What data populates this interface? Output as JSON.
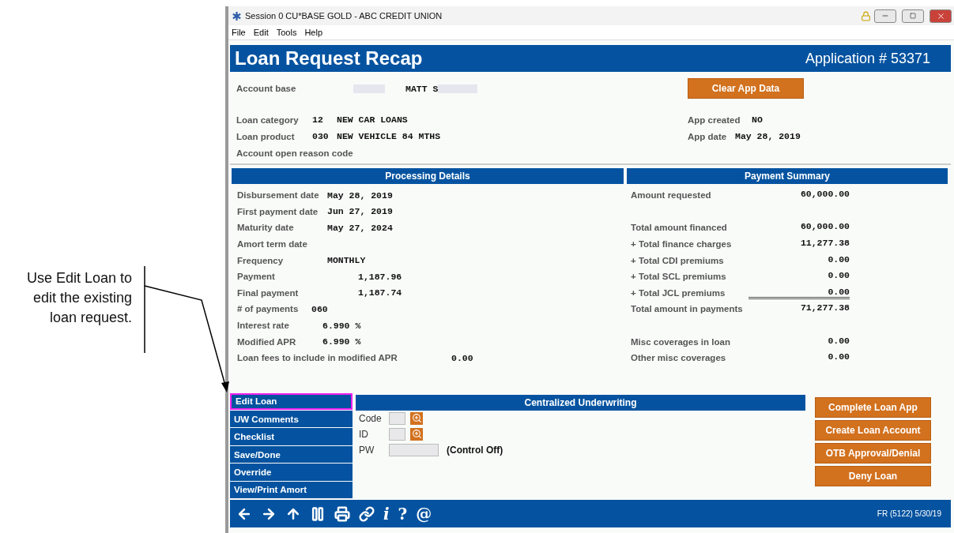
{
  "callout": {
    "text": "Use Edit Loan to edit the existing loan request."
  },
  "window": {
    "title": "Session 0 CU*BASE GOLD - ABC CREDIT UNION"
  },
  "menu": [
    "File",
    "Edit",
    "Tools",
    "Help"
  ],
  "header": {
    "title": "Loan Request Recap",
    "application": "Application # 53371"
  },
  "account": {
    "label": "Account base",
    "name": "MATT S"
  },
  "clear_button": "Clear App Data",
  "loan_info": [
    {
      "label": "Loan category",
      "code": "12",
      "value": "NEW CAR LOANS"
    },
    {
      "label": "Loan product",
      "code": "030",
      "value": "NEW VEHICLE 84 MTHS"
    },
    {
      "label": "Account open reason code"
    }
  ],
  "app_info": [
    {
      "label": "App created",
      "value": "NO"
    },
    {
      "label": "App date",
      "value": "May 28, 2019"
    }
  ],
  "processing": {
    "title": "Processing Details",
    "rows": [
      {
        "label": "Disbursement date",
        "value": "May 28, 2019",
        "kind": "date"
      },
      {
        "label": "First payment date",
        "value": "Jun 27, 2019",
        "kind": "date"
      },
      {
        "label": "Maturity date",
        "value": "May 27, 2024",
        "kind": "date"
      },
      {
        "label": "Amort term date",
        "kind": "date"
      },
      {
        "label": "Frequency",
        "value": "MONTHLY",
        "kind": "date"
      },
      {
        "label": "Payment",
        "value": "1,187.96",
        "kind": "amount"
      },
      {
        "label": "Final payment",
        "value": "1,187.74",
        "kind": "amount"
      },
      {
        "label": "# of payments",
        "value": "060",
        "kind": "count"
      },
      {
        "label": "Interest rate",
        "value": "6.990 %",
        "kind": "rate"
      },
      {
        "label": "Modified APR",
        "value": "6.990 %",
        "kind": "rate"
      },
      {
        "label": "Loan fees to include in modified APR",
        "value": "0.00",
        "kind": "fee"
      }
    ]
  },
  "payment_summary": {
    "title": "Payment Summary",
    "groups": [
      [
        {
          "label": "Amount requested",
          "value": "60,000.00",
          "rule_below": false
        }
      ],
      [
        {
          "label": "Total amount financed",
          "value": "60,000.00",
          "rule_below": false
        },
        {
          "label": "+ Total finance charges",
          "value": "11,277.38",
          "rule_below": false
        },
        {
          "label": "+ Total CDI premiums",
          "value": "0.00",
          "rule_below": false
        },
        {
          "label": "+ Total SCL premiums",
          "value": "0.00",
          "rule_below": false
        },
        {
          "label": "+ Total JCL premiums",
          "value": "0.00",
          "rule_below": true
        },
        {
          "label": "Total amount in payments",
          "value": "71,277.38",
          "rule_below": false
        }
      ],
      [
        {
          "label": "Misc coverages in loan",
          "value": "0.00",
          "rule_below": false
        },
        {
          "label": "Other misc coverages",
          "value": "0.00",
          "rule_below": false
        }
      ]
    ]
  },
  "nav": [
    {
      "label": "Edit Loan",
      "highlighted": true
    },
    {
      "label": "UW Comments",
      "highlighted": false
    },
    {
      "label": "Checklist",
      "highlighted": false
    },
    {
      "label": "Save/Done",
      "highlighted": false
    },
    {
      "label": "Override",
      "highlighted": false
    },
    {
      "label": "View/Print Amort",
      "highlighted": false
    }
  ],
  "underwriting": {
    "title": "Centralized Underwriting",
    "fields": [
      {
        "label": "Code",
        "kind": "lookup"
      },
      {
        "label": "ID",
        "kind": "lookup"
      },
      {
        "label": "PW",
        "kind": "password",
        "note": "(Control Off)"
      }
    ]
  },
  "actions": [
    "Complete Loan App",
    "Create Loan Account",
    "OTB Approval/Denial",
    "Deny Loan"
  ],
  "footer": {
    "tools": [
      {
        "kind": "back"
      },
      {
        "kind": "forward"
      },
      {
        "kind": "up"
      },
      {
        "kind": "pause"
      },
      {
        "kind": "print"
      },
      {
        "kind": "link"
      },
      {
        "kind": "char",
        "text": "i"
      },
      {
        "kind": "char",
        "text": "?"
      },
      {
        "kind": "char",
        "text": "@"
      }
    ],
    "code": "FR (5122) 5/30/19"
  }
}
